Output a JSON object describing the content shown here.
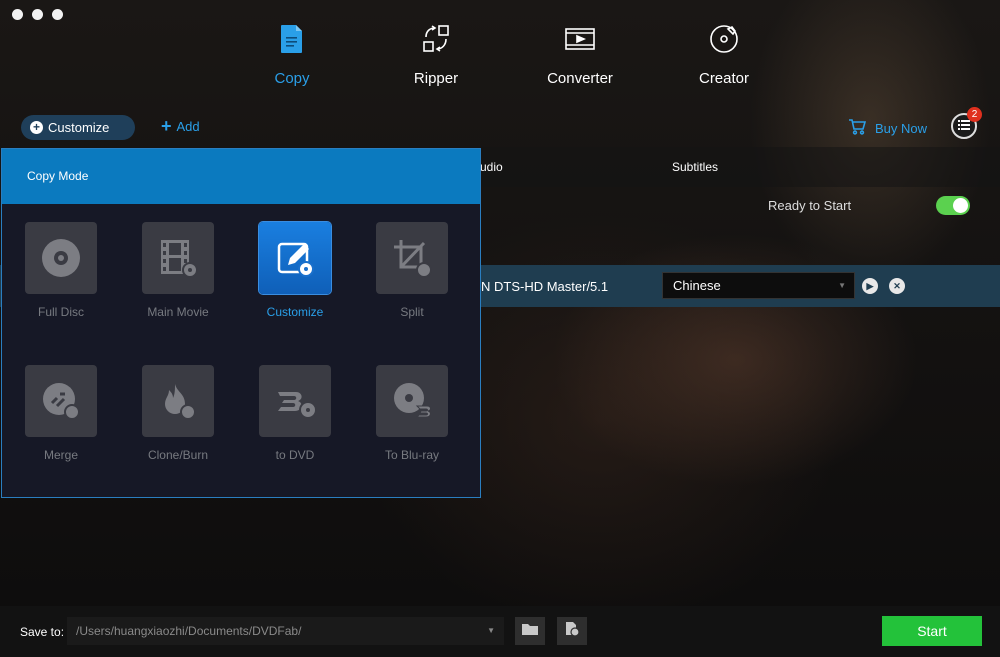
{
  "nav": {
    "copy": "Copy",
    "ripper": "Ripper",
    "converter": "Converter",
    "creator": "Creator"
  },
  "toolbar": {
    "customize": "Customize",
    "add": "Add",
    "buy_now": "Buy Now",
    "queue_count": "2"
  },
  "table": {
    "audio_header": "udio",
    "subtitles_header": "Subtitles",
    "status": "Ready to Start",
    "audio_value": "N  DTS-HD Master/5.1",
    "subtitle_value": "Chinese"
  },
  "copy_mode": {
    "title": "Copy Mode",
    "modes": [
      "Full Disc",
      "Main Movie",
      "Customize",
      "Split",
      "Merge",
      "Clone/Burn",
      "to DVD",
      "To Blu-ray"
    ]
  },
  "footer": {
    "save_to_label": "Save to:",
    "path": "/Users/huangxiaozhi/Documents/DVDFab/",
    "start": "Start"
  },
  "colors": {
    "accent": "#2a9fe8",
    "panel_header": "#0b7abf",
    "start_green": "#23c23a",
    "toggle_green": "#5bd14f",
    "badge_red": "#e0301e"
  }
}
